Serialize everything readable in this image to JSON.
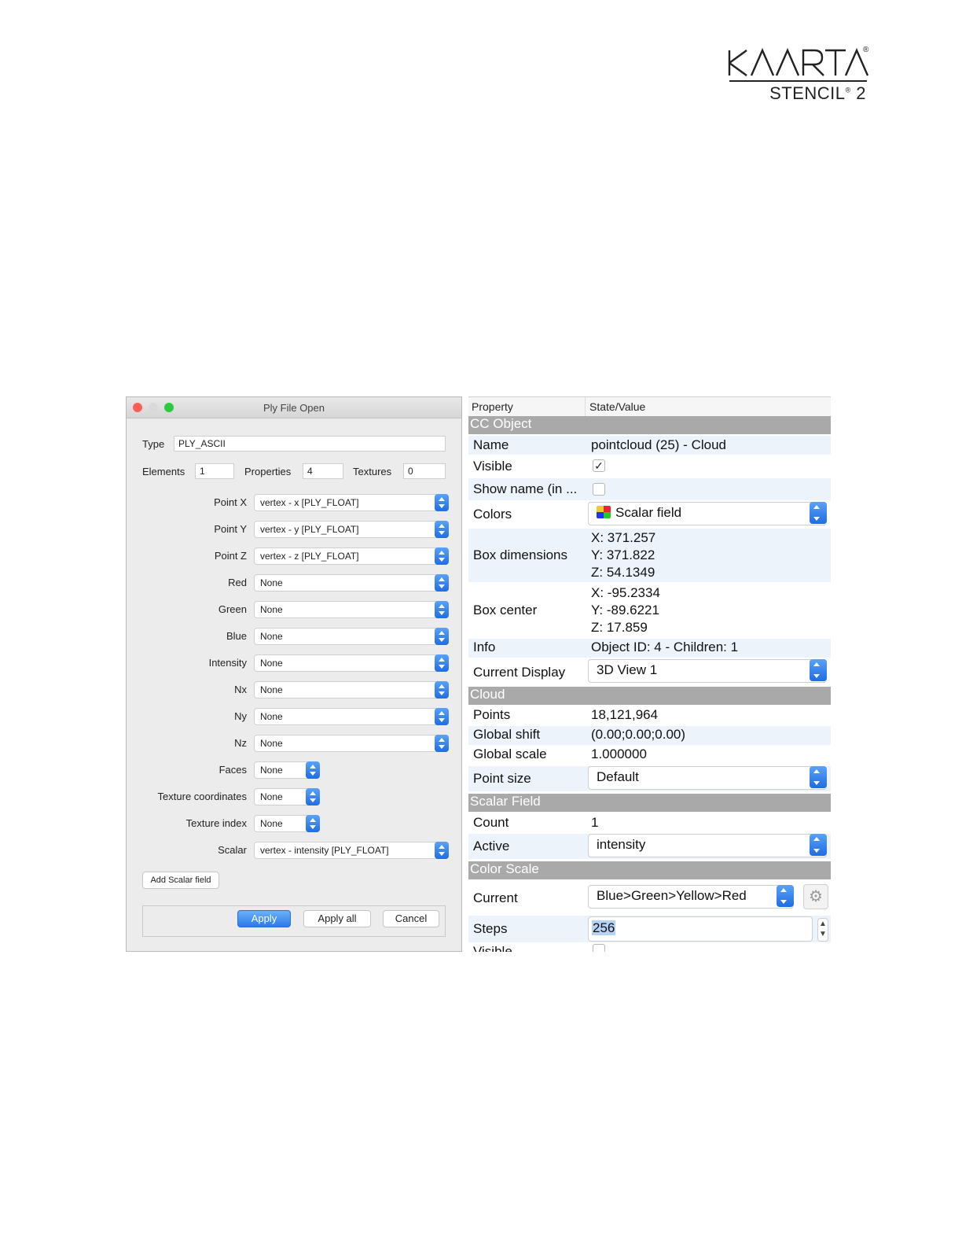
{
  "logo": {
    "brand": "KAARTA",
    "reg_mark": "®",
    "product": "STENCIL",
    "product_sup": "®",
    "product_num": "2"
  },
  "ply_dialog": {
    "title": "Ply File Open",
    "type_label": "Type",
    "type_value": "PLY_ASCII",
    "elements_label": "Elements",
    "elements_value": "1",
    "properties_label": "Properties",
    "properties_value": "4",
    "textures_label": "Textures",
    "textures_value": "0",
    "mappings": [
      {
        "label": "Point X",
        "value": "vertex - x [PLY_FLOAT]"
      },
      {
        "label": "Point Y",
        "value": "vertex - y [PLY_FLOAT]"
      },
      {
        "label": "Point Z",
        "value": "vertex - z [PLY_FLOAT]"
      },
      {
        "label": "Red",
        "value": "None"
      },
      {
        "label": "Green",
        "value": "None"
      },
      {
        "label": "Blue",
        "value": "None"
      },
      {
        "label": "Intensity",
        "value": "None"
      },
      {
        "label": "Nx",
        "value": "None"
      },
      {
        "label": "Ny",
        "value": "None"
      },
      {
        "label": "Nz",
        "value": "None"
      }
    ],
    "short_mappings": [
      {
        "label": "Faces",
        "value": "None"
      },
      {
        "label": "Texture coordinates",
        "value": "None"
      },
      {
        "label": "Texture index",
        "value": "None"
      }
    ],
    "scalar_label": "Scalar",
    "scalar_value": "vertex - intensity [PLY_FLOAT]",
    "add_scalar_label": "Add Scalar field",
    "apply_label": "Apply",
    "apply_all_label": "Apply all",
    "cancel_label": "Cancel"
  },
  "properties": {
    "col_property": "Property",
    "col_value": "State/Value",
    "sec_cc_object": "CC Object",
    "name_key": "Name",
    "name_value": "pointcloud (25) - Cloud",
    "visible_key": "Visible",
    "show_name_key": "Show name (in ...",
    "colors_key": "Colors",
    "colors_value": "Scalar field",
    "box_dim_key": "Box dimensions",
    "box_dim_x": "X: 371.257",
    "box_dim_y": "Y: 371.822",
    "box_dim_z": "Z: 54.1349",
    "box_center_key": "Box center",
    "box_center_x": "X: -95.2334",
    "box_center_y": "Y: -89.6221",
    "box_center_z": "Z: 17.859",
    "info_key": "Info",
    "info_value": "Object ID: 4 - Children: 1",
    "display_key": "Current Display",
    "display_value": "3D View 1",
    "sec_cloud": "Cloud",
    "points_key": "Points",
    "points_value": "18,121,964",
    "shift_key": "Global shift",
    "shift_value": "(0.00;0.00;0.00)",
    "scale_key": "Global scale",
    "scale_value": "1.000000",
    "psize_key": "Point size",
    "psize_value": "Default",
    "sec_scalar": "Scalar Field",
    "count_key": "Count",
    "count_value": "1",
    "active_key": "Active",
    "active_value": "intensity",
    "sec_color_scale": "Color Scale",
    "current_key": "Current",
    "current_value": "Blue>Green>Yellow>Red",
    "steps_key": "Steps",
    "steps_value": "256",
    "visible2_key": "Visible"
  },
  "colors": {
    "accent_blue": "#2b7be8",
    "section_gray": "#a9a9a9",
    "row_alt": "#edf3fb"
  }
}
